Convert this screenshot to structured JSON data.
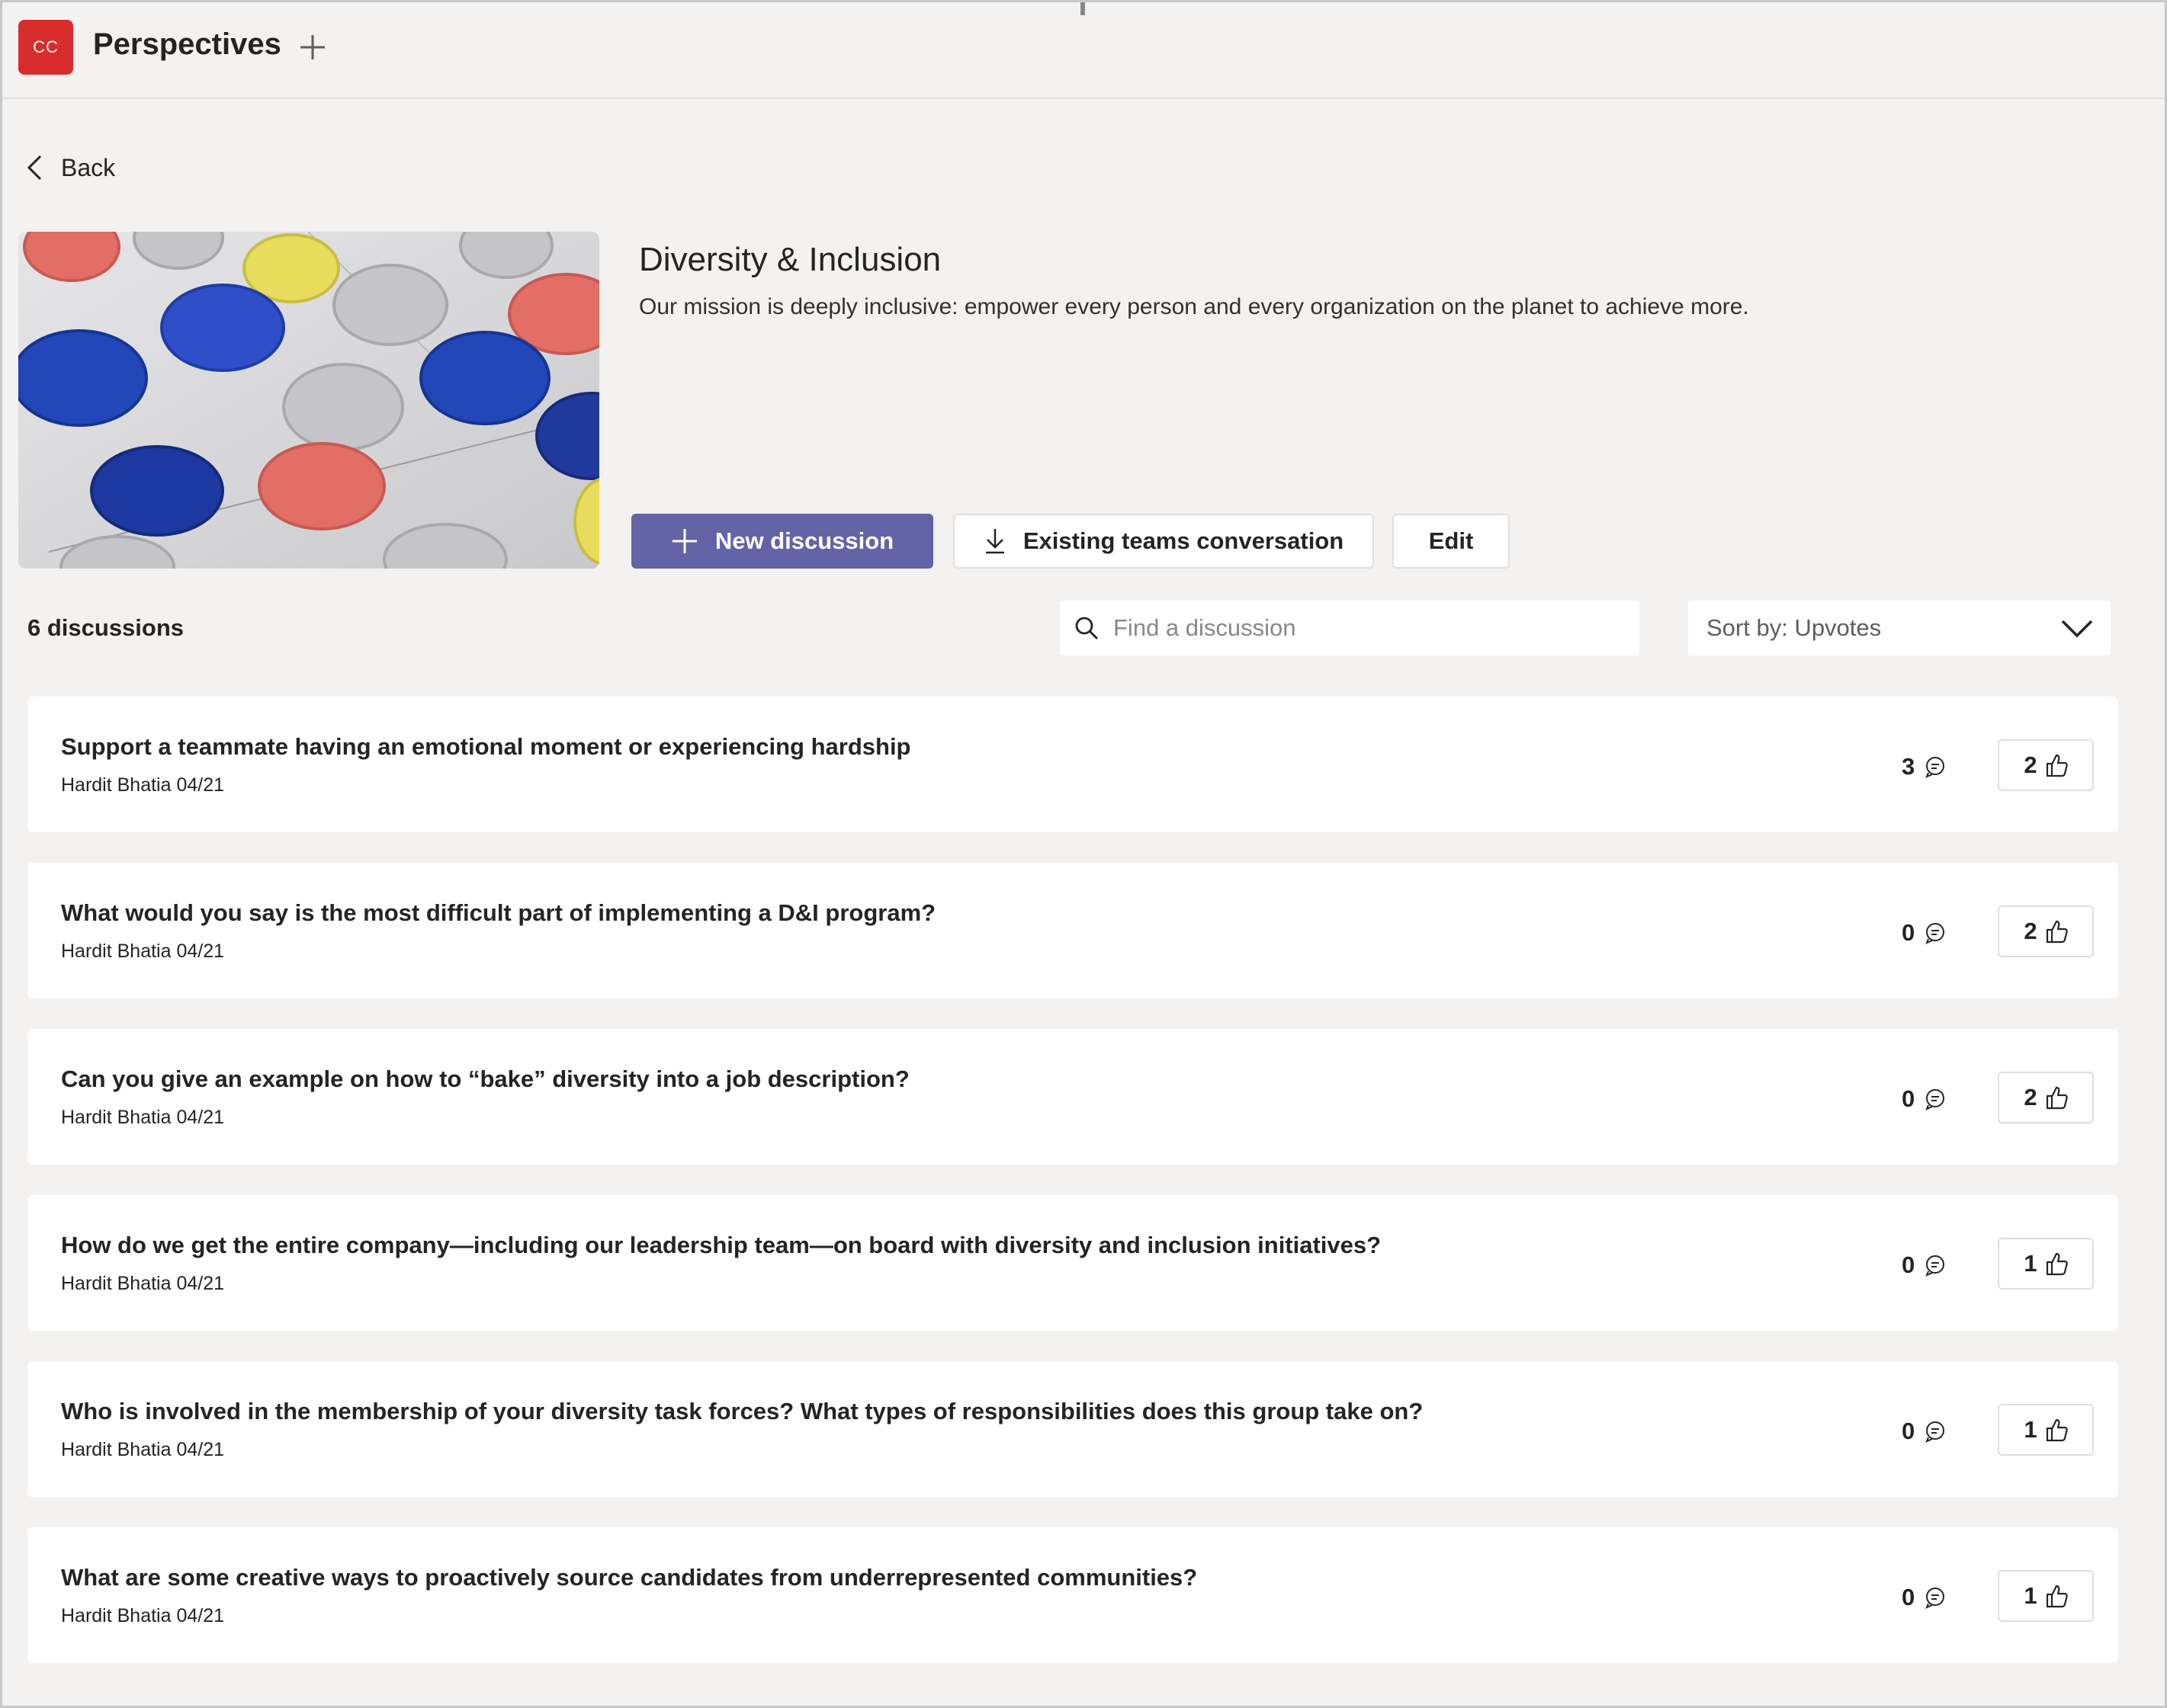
{
  "header": {
    "app_icon_text": "CC",
    "app_title": "Perspectives",
    "add_tab_icon": "plus-icon"
  },
  "nav": {
    "back_label": "Back"
  },
  "topic": {
    "title": "Diversity & Inclusion",
    "description": "Our mission is deeply inclusive: empower every person and every organization on the planet to achieve more."
  },
  "actions": {
    "new_discussion": "New discussion",
    "existing_conversation": "Existing teams conversation",
    "edit": "Edit"
  },
  "toolbar": {
    "count_label": "6 discussions",
    "search_placeholder": "Find a discussion",
    "sort_label": "Sort by: Upvotes"
  },
  "colors": {
    "accent": "#6264a7",
    "app_icon": "#d92c2c",
    "background": "#f3f2f1",
    "card": "#ffffff"
  },
  "discussions": [
    {
      "title": "Support a teammate having an emotional moment or experiencing hardship",
      "meta": "Hardit Bhatia 04/21",
      "comments": "3",
      "upvotes": "2"
    },
    {
      "title": "What would you say is the most difficult part of implementing a D&I program?",
      "meta": "Hardit Bhatia 04/21",
      "comments": "0",
      "upvotes": "2"
    },
    {
      "title": "Can you give an example on how to “bake” diversity into a job description?",
      "meta": "Hardit Bhatia 04/21",
      "comments": "0",
      "upvotes": "2"
    },
    {
      "title": "How do we get the entire company—including our leadership team—on board with diversity and inclusion initiatives?",
      "meta": "Hardit Bhatia 04/21",
      "comments": "0",
      "upvotes": "1"
    },
    {
      "title": "Who is involved in the membership of your diversity task forces? What types of responsibilities does this group take on?",
      "meta": "Hardit Bhatia 04/21",
      "comments": "0",
      "upvotes": "1"
    },
    {
      "title": "What are some creative ways to proactively source candidates from underrepresented communities?",
      "meta": "Hardit Bhatia 04/21",
      "comments": "0",
      "upvotes": "1"
    }
  ]
}
